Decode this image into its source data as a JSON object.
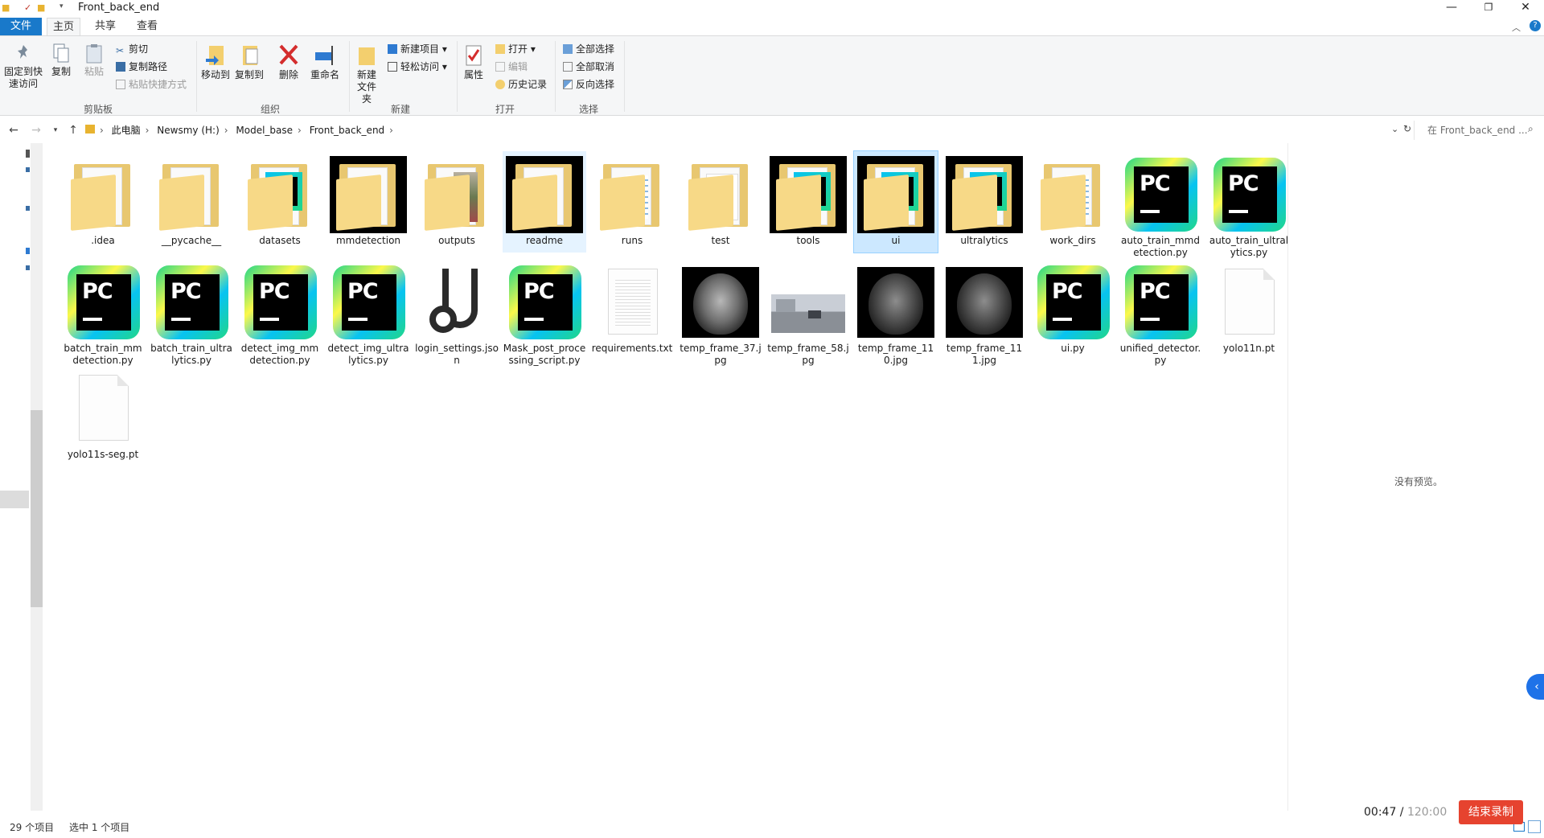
{
  "window": {
    "title": "Front_back_end"
  },
  "tabs": [
    {
      "label": "文件"
    },
    {
      "label": "主页"
    },
    {
      "label": "共享"
    },
    {
      "label": "查看"
    }
  ],
  "ribbon": {
    "clipboard": {
      "pin": "固定到快速访问",
      "copy": "复制",
      "paste": "粘贴",
      "cut": "剪切",
      "copy_path": "复制路径",
      "paste_shortcut": "粘贴快捷方式",
      "label": "剪贴板"
    },
    "organize": {
      "move_to": "移动到",
      "copy_to": "复制到",
      "delete": "删除",
      "rename": "重命名",
      "label": "组织"
    },
    "new": {
      "new_folder": "新建文件夹",
      "new_item": "新建项目",
      "easy_access": "轻松访问",
      "label": "新建"
    },
    "open": {
      "properties": "属性",
      "open": "打开",
      "edit": "编辑",
      "history": "历史记录",
      "label": "打开"
    },
    "select": {
      "select_all": "全部选择",
      "select_none": "全部取消",
      "invert": "反向选择",
      "label": "选择"
    }
  },
  "address": {
    "crumbs": [
      "此电脑",
      "Newsmy (H:)",
      "Model_base",
      "Front_back_end"
    ],
    "search_placeholder": "在 Front_back_end ..."
  },
  "items": [
    {
      "name": ".idea",
      "type": "folder-edge"
    },
    {
      "name": "__pycache__",
      "type": "folder"
    },
    {
      "name": "datasets",
      "type": "folder-pc"
    },
    {
      "name": "mmdetection",
      "type": "folder-dark"
    },
    {
      "name": "outputs",
      "type": "folder-img"
    },
    {
      "name": "readme",
      "type": "folder-dark",
      "state": "hover"
    },
    {
      "name": "runs",
      "type": "folder-doc"
    },
    {
      "name": "test",
      "type": "folder-mp4"
    },
    {
      "name": "tools",
      "type": "folder-dark-pc"
    },
    {
      "name": "ui",
      "type": "folder-dark-pc",
      "state": "selected"
    },
    {
      "name": "ultralytics",
      "type": "folder-dark-pc"
    },
    {
      "name": "work_dirs",
      "type": "folder-doc"
    },
    {
      "name": "auto_train_mmdetection.py",
      "type": "pycharm"
    },
    {
      "name": "auto_train_ultralytics.py",
      "type": "pycharm"
    },
    {
      "name": "batch_train_mmdetection.py",
      "type": "pycharm"
    },
    {
      "name": "batch_train_ultralytics.py",
      "type": "pycharm"
    },
    {
      "name": "detect_img_mmdetection.py",
      "type": "pycharm"
    },
    {
      "name": "detect_img_ultralytics.py",
      "type": "pycharm"
    },
    {
      "name": "login_settings.json",
      "type": "json"
    },
    {
      "name": "Mask_post_processing_script.py",
      "type": "pycharm"
    },
    {
      "name": "requirements.txt",
      "type": "txt"
    },
    {
      "name": "temp_frame_37.jpg",
      "type": "brain-bright"
    },
    {
      "name": "temp_frame_58.jpg",
      "type": "street"
    },
    {
      "name": "temp_frame_110.jpg",
      "type": "brain"
    },
    {
      "name": "temp_frame_111.jpg",
      "type": "brain"
    },
    {
      "name": "ui.py",
      "type": "pycharm"
    },
    {
      "name": "unified_detector.py",
      "type": "pycharm"
    },
    {
      "name": "yolo11n.pt",
      "type": "blank"
    },
    {
      "name": "yolo11s-seg.pt",
      "type": "blank"
    }
  ],
  "preview": {
    "empty_text": "没有预览。"
  },
  "status": {
    "count": "29 个项目",
    "selected": "选中 1 个项目"
  },
  "recorder": {
    "elapsed": "00:47",
    "separator": " / ",
    "total": "120:00",
    "stop_label": "结束录制"
  },
  "colors": {
    "accent": "#1979ca",
    "selected_bg": "#cce8ff",
    "stop_button": "#e6432f"
  }
}
